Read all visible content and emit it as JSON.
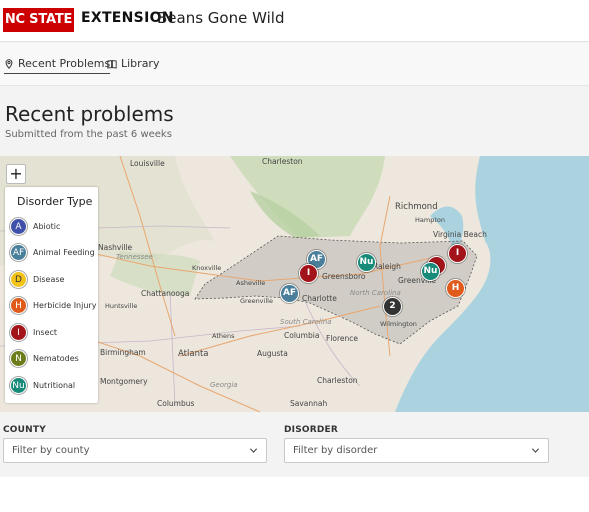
{
  "header": {
    "logo_text": "NC STATE",
    "extension_label": "EXTENSION",
    "app_title": "Beans Gone Wild"
  },
  "tabs": [
    {
      "label": "Recent Problems",
      "icon": "location-pin-icon",
      "active": true
    },
    {
      "label": "Library",
      "icon": "book-icon",
      "active": false
    }
  ],
  "page": {
    "title": "Recent problems",
    "subtitle": "Submitted from the past 6 weeks"
  },
  "map": {
    "zoom_in_label": "+",
    "legend": {
      "title": "Disorder Type",
      "items": [
        {
          "letter": "A",
          "label": "Abiotic",
          "color": "#3f51a8"
        },
        {
          "letter": "AF",
          "label": "Animal Feeding",
          "color": "#4a7f9b"
        },
        {
          "letter": "D",
          "label": "Disease",
          "color": "#f2c318"
        },
        {
          "letter": "H",
          "label": "Herbicide Injury",
          "color": "#e05a1c"
        },
        {
          "letter": "I",
          "label": "Insect",
          "color": "#a3131a"
        },
        {
          "letter": "N",
          "label": "Nematodes",
          "color": "#6e7d1c"
        },
        {
          "letter": "Nu",
          "label": "Nutritional",
          "color": "#178a7a"
        }
      ]
    },
    "markers": [
      {
        "text": "AF",
        "color": "#4a7f9b"
      },
      {
        "text": "I",
        "color": "#a3131a"
      },
      {
        "text": "AF",
        "color": "#4a7f9b"
      },
      {
        "text": "Nu",
        "color": "#178a7a"
      },
      {
        "text": "Nu",
        "color": "#178a7a"
      },
      {
        "text": "I",
        "color": "#a3131a"
      },
      {
        "text": "",
        "color": "#a3131a"
      },
      {
        "text": "H",
        "color": "#e05a1c"
      },
      {
        "text": "2",
        "color": "#333333"
      }
    ],
    "cities": [
      "Louisville",
      "Charleston",
      "Richmond",
      "Hampton",
      "Virginia Beach",
      "Nashville",
      "Knoxville",
      "Asheville",
      "Greenville",
      "Chattanooga",
      "Huntsville",
      "Athens",
      "Columbia",
      "Florence",
      "Wilmington",
      "Atlanta",
      "Augusta",
      "Charleston",
      "Birmingham",
      "Montgomery",
      "Columbus",
      "Savannah",
      "Raleigh",
      "Charlotte",
      "Greensboro",
      "Greenville"
    ],
    "state_labels": [
      "North Carolina",
      "Tennessee",
      "Georgia",
      "South Carolina"
    ]
  },
  "filters": {
    "county": {
      "label": "COUNTY",
      "placeholder": "Filter by county"
    },
    "disorder": {
      "label": "DISORDER",
      "placeholder": "Filter by disorder"
    }
  }
}
